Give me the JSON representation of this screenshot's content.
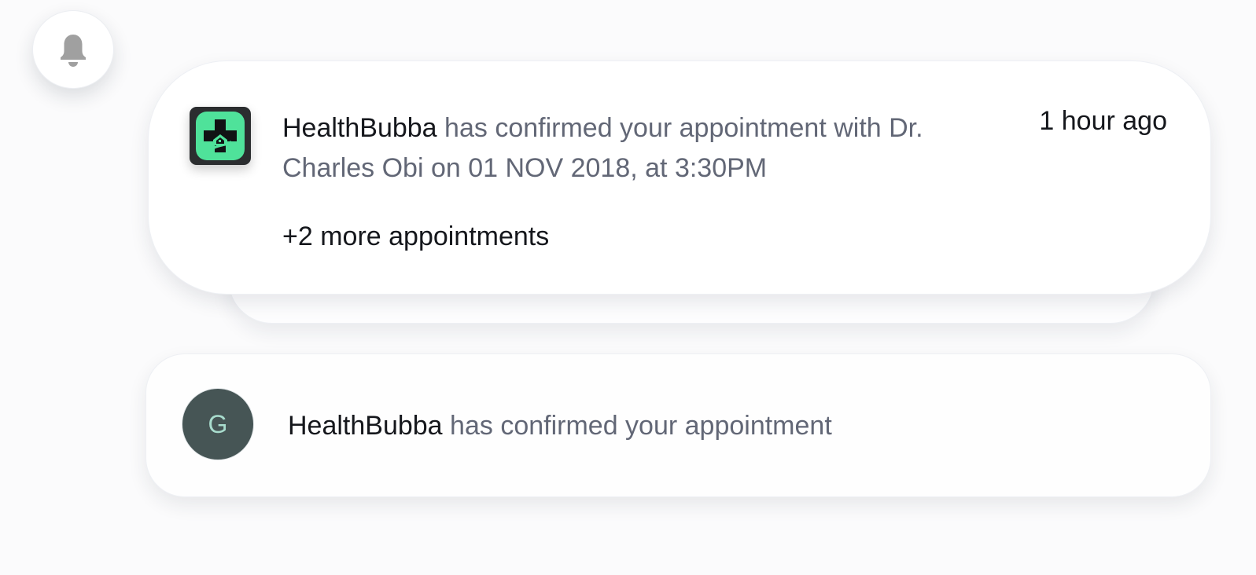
{
  "bell": {
    "icon": "bell-icon",
    "color": "#a0a0a0"
  },
  "notifications": [
    {
      "app_icon": "healthbubba-logo-icon",
      "sender": "HealthBubba",
      "message": " has confirmed your appointment with Dr. Charles Obi on 01 NOV 2018, at 3:30PM",
      "time": "1 hour ago",
      "more": "+2 more appointments",
      "logo_bg": "#2b2d2f",
      "logo_accent": "#4fe29a"
    },
    {
      "avatar_initial": "G",
      "sender": "HealthBubba",
      "message": " has confirmed your appointment",
      "avatar_bg": "#465555",
      "avatar_text_color": "#a8dccd"
    }
  ],
  "colors": {
    "primary_text": "#15171c",
    "secondary_text": "#626776",
    "background": "#fbfbfc"
  }
}
